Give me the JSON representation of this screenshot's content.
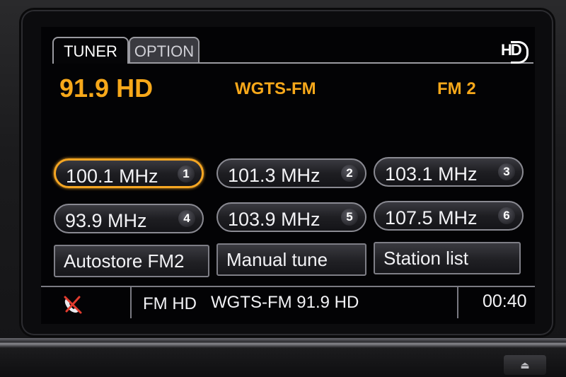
{
  "tabs": {
    "tuner": "TUNER",
    "option": "OPTION"
  },
  "hd_logo": "HD",
  "now_playing": {
    "frequency": "91.9 HD",
    "station": "WGTS-FM",
    "band": "FM 2"
  },
  "presets": [
    {
      "label": "100.1 MHz",
      "number": "1",
      "selected": true
    },
    {
      "label": "101.3 MHz",
      "number": "2",
      "selected": false
    },
    {
      "label": "103.1 MHz",
      "number": "3",
      "selected": false
    },
    {
      "label": "93.9 MHz",
      "number": "4",
      "selected": false
    },
    {
      "label": "103.9 MHz",
      "number": "5",
      "selected": false
    },
    {
      "label": "107.5 MHz",
      "number": "6",
      "selected": false
    }
  ],
  "actions": {
    "autostore": "Autostore FM2",
    "manual_tune": "Manual tune",
    "station_list": "Station list"
  },
  "status_bar": {
    "phone_icon": "phone-disconnected-icon",
    "mode": "FM HD",
    "info": "WGTS-FM 91.9 HD",
    "time": "00:40"
  },
  "colors": {
    "accent": "#f7a81a",
    "text": "#f2f2f5",
    "background": "#030305"
  }
}
